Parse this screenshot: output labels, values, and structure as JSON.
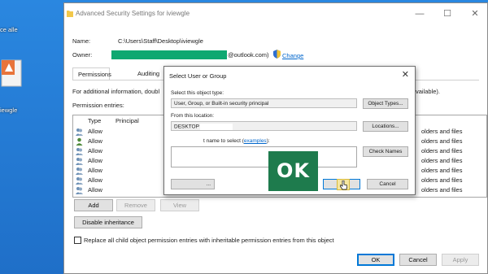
{
  "desktop": {
    "icon1_label": "ce alle",
    "icon2_label": "iewgle"
  },
  "window": {
    "title": "Advanced Security Settings for iviewgle",
    "name_label": "Name:",
    "name_value": "C:\\Users\\Staff\\Desktop\\iviewgle",
    "owner_label": "Owner:",
    "owner_value_suffix": "@outlook.com)",
    "change_link": "Change",
    "tabs": [
      {
        "label": "Permissions",
        "active": true
      },
      {
        "label": "Auditing",
        "active": false
      }
    ],
    "info_text": "For additional information, doubl",
    "info_text_right": "vailable).",
    "perm_entries_label": "Permission entries:",
    "columns": [
      "Type",
      "Principal"
    ],
    "rows": [
      {
        "type": "Allow",
        "applies": "olders and files"
      },
      {
        "type": "Allow",
        "applies": "olders and files"
      },
      {
        "type": "Allow",
        "applies": "olders and files"
      },
      {
        "type": "Allow",
        "applies": "olders and files"
      },
      {
        "type": "Allow",
        "applies": "olders and files"
      },
      {
        "type": "Allow",
        "applies": "olders and files"
      },
      {
        "type": "Allow",
        "applies": "olders and files"
      }
    ],
    "buttons": {
      "add": "Add",
      "remove": "Remove",
      "view": "View",
      "disable_inheritance": "Disable inheritance",
      "ok": "OK",
      "cancel": "Cancel",
      "apply": "Apply"
    },
    "replace_checkbox_label": "Replace all child object permission entries with inheritable permission entries from this object"
  },
  "dialog": {
    "title": "Select User or Group",
    "object_type_label": "Select this object type:",
    "object_type_value": "User, Group, or Built-in security principal",
    "object_types_button": "Object Types...",
    "location_label": "From this location:",
    "location_value": "DESKTOP",
    "locations_button": "Locations...",
    "enter_name_label": "t name to select (",
    "examples_link": "examples",
    "enter_name_suffix": "):",
    "check_names_button": "Check Names",
    "advanced_button_partial": "...",
    "ok_button": "OK",
    "cancel_button": "Cancel"
  },
  "overlay": {
    "ok_badge": "OK"
  },
  "colors": {
    "desktop": "#1f6fc8",
    "owner_redaction": "#0fa871",
    "ok_badge": "#1e7b4d",
    "link": "#0066cc",
    "highlight": "#f5e6a0"
  }
}
